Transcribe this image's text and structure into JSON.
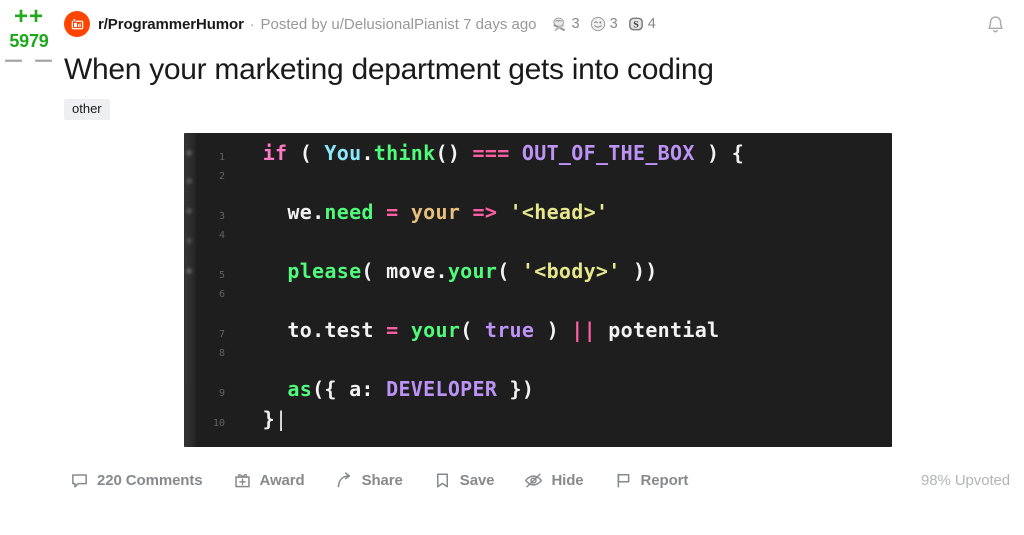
{
  "vote": {
    "upvote_label": "++",
    "downvote_label": "－ －",
    "score": "5979"
  },
  "header": {
    "subreddit": "r/ProgrammerHumor",
    "separator": "·",
    "posted_by": "Posted by u/DelusionalPianist 7 days ago",
    "avatar_icon": "subreddit-avatar-icon",
    "bell_icon": "notification-bell-icon",
    "awards": [
      {
        "icon": "wholesome-award-icon",
        "count": "3"
      },
      {
        "icon": "smile-award-icon",
        "count": "3"
      },
      {
        "icon": "silver-award-icon",
        "count": "4"
      }
    ]
  },
  "post": {
    "title": "When your marketing department gets into coding",
    "flair": "other"
  },
  "code": {
    "lines": [
      {
        "number": "1",
        "tokens": [
          {
            "t": "  ",
            "c": "t-plain"
          },
          {
            "t": "if",
            "c": "t-kw"
          },
          {
            "t": " ( ",
            "c": "t-plain"
          },
          {
            "t": "You",
            "c": "t-class"
          },
          {
            "t": ".",
            "c": "t-plain"
          },
          {
            "t": "think",
            "c": "t-fn"
          },
          {
            "t": "() ",
            "c": "t-plain"
          },
          {
            "t": "===",
            "c": "t-op"
          },
          {
            "t": " ",
            "c": "t-plain"
          },
          {
            "t": "OUT_OF_THE_BOX",
            "c": "t-const"
          },
          {
            "t": " ) {",
            "c": "t-plain"
          }
        ]
      },
      {
        "number": "2",
        "tokens": []
      },
      {
        "number": "3",
        "tokens": [
          {
            "t": "    ",
            "c": "t-plain"
          },
          {
            "t": "we",
            "c": "t-plain"
          },
          {
            "t": ".",
            "c": "t-plain"
          },
          {
            "t": "need",
            "c": "t-fn"
          },
          {
            "t": " ",
            "c": "t-plain"
          },
          {
            "t": "=",
            "c": "t-op"
          },
          {
            "t": " ",
            "c": "t-plain"
          },
          {
            "t": "your",
            "c": "t-var"
          },
          {
            "t": " ",
            "c": "t-plain"
          },
          {
            "t": "=>",
            "c": "t-op"
          },
          {
            "t": " ",
            "c": "t-plain"
          },
          {
            "t": "'<head>'",
            "c": "t-str"
          }
        ]
      },
      {
        "number": "4",
        "tokens": []
      },
      {
        "number": "5",
        "tokens": [
          {
            "t": "    ",
            "c": "t-plain"
          },
          {
            "t": "please",
            "c": "t-fn"
          },
          {
            "t": "( ",
            "c": "t-plain"
          },
          {
            "t": "move",
            "c": "t-plain"
          },
          {
            "t": ".",
            "c": "t-plain"
          },
          {
            "t": "your",
            "c": "t-fn"
          },
          {
            "t": "( ",
            "c": "t-plain"
          },
          {
            "t": "'<body>'",
            "c": "t-str"
          },
          {
            "t": " ))",
            "c": "t-plain"
          }
        ]
      },
      {
        "number": "6",
        "tokens": []
      },
      {
        "number": "7",
        "tokens": [
          {
            "t": "    ",
            "c": "t-plain"
          },
          {
            "t": "to",
            "c": "t-plain"
          },
          {
            "t": ".",
            "c": "t-plain"
          },
          {
            "t": "test",
            "c": "t-plain"
          },
          {
            "t": " ",
            "c": "t-plain"
          },
          {
            "t": "=",
            "c": "t-op"
          },
          {
            "t": " ",
            "c": "t-plain"
          },
          {
            "t": "your",
            "c": "t-fn"
          },
          {
            "t": "( ",
            "c": "t-plain"
          },
          {
            "t": "true",
            "c": "t-const"
          },
          {
            "t": " ) ",
            "c": "t-plain"
          },
          {
            "t": "||",
            "c": "t-op"
          },
          {
            "t": " potential",
            "c": "t-plain"
          }
        ]
      },
      {
        "number": "8",
        "tokens": []
      },
      {
        "number": "9",
        "tokens": [
          {
            "t": "    ",
            "c": "t-plain"
          },
          {
            "t": "as",
            "c": "t-fn"
          },
          {
            "t": "({ a: ",
            "c": "t-plain"
          },
          {
            "t": "DEVELOPER",
            "c": "t-const"
          },
          {
            "t": " })",
            "c": "t-plain"
          }
        ]
      },
      {
        "number": "10",
        "tokens": [
          {
            "t": "  }",
            "c": "t-plain"
          },
          {
            "t": "|",
            "c": "cursor"
          }
        ]
      }
    ]
  },
  "actions": {
    "comments": "220 Comments",
    "award": "Award",
    "share": "Share",
    "save": "Save",
    "hide": "Hide",
    "report": "Report",
    "upvoted_percent": "98% Upvoted"
  },
  "colors": {
    "brand_orange": "#ff4500",
    "upvote_green": "#24a81c",
    "muted_gray": "#878a8c",
    "code_bg": "#1e1e1e"
  }
}
